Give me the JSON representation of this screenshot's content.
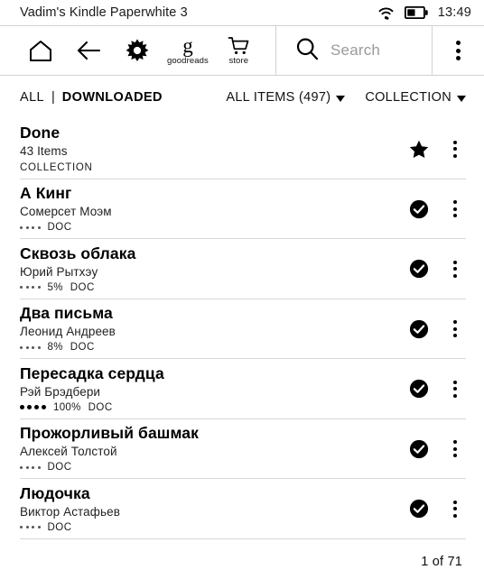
{
  "status_bar": {
    "device_name": "Vadim's Kindle Paperwhite 3",
    "clock": "13:49",
    "wifi_icon": "wifi-icon",
    "battery_icon": "battery-icon",
    "battery_level_pct": 45
  },
  "toolbar": {
    "home_label": "home-icon",
    "back_label": "back-arrow-icon",
    "settings_label": "settings-icon",
    "goodreads_glyph": "g",
    "goodreads_label": "goodreads",
    "store_label": "store",
    "store_icon": "shopping-cart-icon",
    "search_placeholder": "Search",
    "search_value": "",
    "search_icon": "magnifier-icon",
    "overflow_icon": "kebab-menu-icon"
  },
  "filter_bar": {
    "all_label": "ALL",
    "separator": "|",
    "downloaded_label": "DOWNLOADED",
    "items_filter_label": "ALL ITEMS (497)",
    "collection_filter_label": "COLLECTION"
  },
  "library": {
    "rows": [
      {
        "title": "Done",
        "subtitle": "43 Items",
        "kind_label": "COLLECTION",
        "type": "collection",
        "percent": "",
        "format": "",
        "dots": 0,
        "dots_full": false,
        "action_icon": "star-icon"
      },
      {
        "title": "А Кинг",
        "subtitle": "Сомерсет Моэм",
        "kind_label": "",
        "type": "book",
        "percent": "",
        "format": "DOC",
        "dots": 4,
        "dots_full": false,
        "action_icon": "check-circle-icon"
      },
      {
        "title": "Сквозь облака",
        "subtitle": "Юрий Рытхэу",
        "kind_label": "",
        "type": "book",
        "percent": "5%",
        "format": "DOC",
        "dots": 4,
        "dots_full": false,
        "action_icon": "check-circle-icon"
      },
      {
        "title": "Два письма",
        "subtitle": "Леонид Андреев",
        "kind_label": "",
        "type": "book",
        "percent": "8%",
        "format": "DOC",
        "dots": 4,
        "dots_full": false,
        "action_icon": "check-circle-icon"
      },
      {
        "title": "Пересадка сердца",
        "subtitle": "Рэй Брэдбери",
        "kind_label": "",
        "type": "book",
        "percent": "100%",
        "format": "DOC",
        "dots": 4,
        "dots_full": true,
        "action_icon": "check-circle-icon"
      },
      {
        "title": "Прожорливый башмак",
        "subtitle": "Алексей Толстой",
        "kind_label": "",
        "type": "book",
        "percent": "",
        "format": "DOC",
        "dots": 4,
        "dots_full": false,
        "action_icon": "check-circle-icon"
      },
      {
        "title": "Людочка",
        "subtitle": "Виктор Астафьев",
        "kind_label": "",
        "type": "book",
        "percent": "",
        "format": "DOC",
        "dots": 4,
        "dots_full": false,
        "action_icon": "check-circle-icon"
      }
    ]
  },
  "footer": {
    "page_indicator": "1 of 71"
  },
  "colors": {
    "background": "#ffffff",
    "text": "#000000",
    "muted_text": "#9a9a9a",
    "divider": "#d8d8d8",
    "toolbar_border": "#d2d2d2"
  }
}
